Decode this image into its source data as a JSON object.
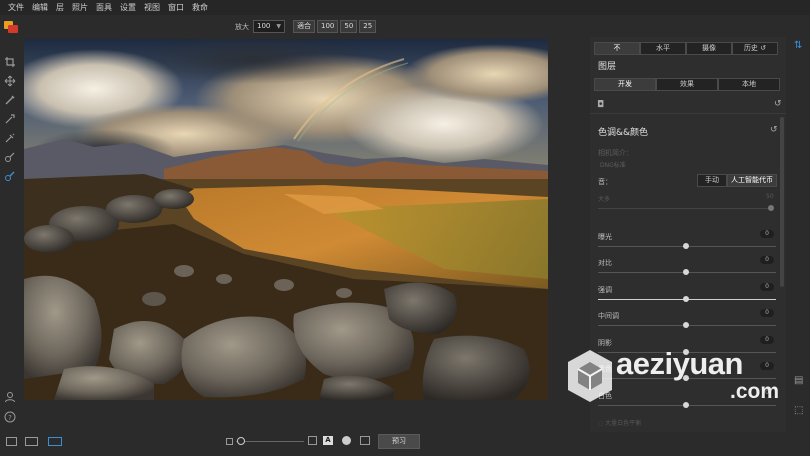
{
  "menu": [
    "文件",
    "编辑",
    "层",
    "照片",
    "面具",
    "设置",
    "视图",
    "窗口",
    "救命"
  ],
  "zoom": {
    "label": "放大",
    "value": "100",
    "fit_label": "適合",
    "presets": [
      "100",
      "50",
      "25"
    ]
  },
  "panel": {
    "top_tabs": [
      "不",
      "水平",
      "摄像",
      "历史"
    ],
    "layers_title": "图层",
    "layer_tabs": [
      "开发",
      "效果",
      "本地"
    ],
    "section_title": "色调&&颜色",
    "profile_label": "相机简介：",
    "profile_value": "DNG标准",
    "mode_label": "音：",
    "mode_options": [
      "手动",
      "人工智能代币"
    ],
    "amount_label": "大多",
    "amount_value": "50",
    "sliders": [
      {
        "name": "曝光",
        "value": "0"
      },
      {
        "name": "对比",
        "value": "0"
      },
      {
        "name": "强调",
        "value": "0"
      },
      {
        "name": "中间调",
        "value": "0"
      },
      {
        "name": "阴影",
        "value": "0"
      },
      {
        "name": "黑色",
        "value": "0"
      },
      {
        "name": "白色",
        "value": "0"
      }
    ],
    "bottom_hint": "大量白色平衡"
  },
  "bottombar": {
    "preview_label": "预习"
  },
  "watermark": {
    "name": "aeziyuan",
    "tld": ".com"
  },
  "colors": {
    "accent": "#3b8fd6",
    "panel_bg": "#2e2e2e",
    "app_bg": "#2b2b2b"
  }
}
